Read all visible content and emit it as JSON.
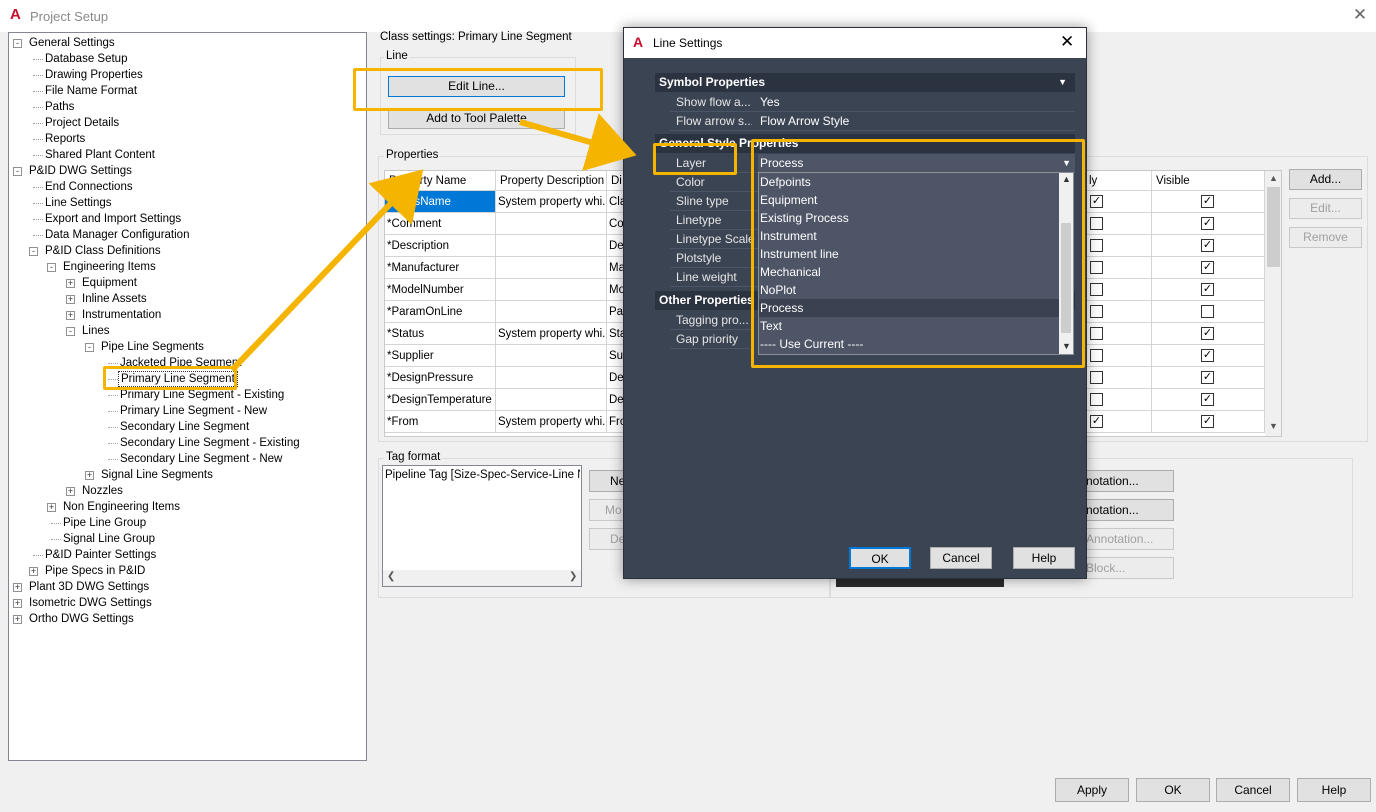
{
  "window": {
    "title": "Project Setup",
    "logo": "A"
  },
  "tree": [
    {
      "label": "General Settings",
      "level": 0,
      "toggle": "-"
    },
    {
      "label": "Database Setup",
      "level": 1
    },
    {
      "label": "Drawing Properties",
      "level": 1
    },
    {
      "label": "File Name Format",
      "level": 1
    },
    {
      "label": "Paths",
      "level": 1
    },
    {
      "label": "Project Details",
      "level": 1
    },
    {
      "label": "Reports",
      "level": 1
    },
    {
      "label": "Shared Plant Content",
      "level": 1
    },
    {
      "label": "P&ID DWG Settings",
      "level": 0,
      "toggle": "-"
    },
    {
      "label": "End Connections",
      "level": 1
    },
    {
      "label": "Line Settings",
      "level": 1
    },
    {
      "label": "Export and Import Settings",
      "level": 1
    },
    {
      "label": "Data Manager Configuration",
      "level": 1
    },
    {
      "label": "P&ID Class Definitions",
      "level": 1,
      "toggle": "-"
    },
    {
      "label": "Engineering Items",
      "level": 2,
      "toggle": "-"
    },
    {
      "label": "Equipment",
      "level": 3,
      "toggle": "+"
    },
    {
      "label": "Inline Assets",
      "level": 3,
      "toggle": "+"
    },
    {
      "label": "Instrumentation",
      "level": 3,
      "toggle": "+"
    },
    {
      "label": "Lines",
      "level": 3,
      "toggle": "-"
    },
    {
      "label": "Pipe Line Segments",
      "level": 4,
      "toggle": "-"
    },
    {
      "label": "Jacketed Pipe Segment",
      "level": 5
    },
    {
      "label": "Primary Line Segment",
      "level": 5,
      "selected": true
    },
    {
      "label": "Primary Line Segment - Existing",
      "level": 5
    },
    {
      "label": "Primary Line Segment - New",
      "level": 5
    },
    {
      "label": "Secondary Line Segment",
      "level": 5
    },
    {
      "label": "Secondary Line Segment - Existing",
      "level": 5
    },
    {
      "label": "Secondary Line Segment - New",
      "level": 5
    },
    {
      "label": "Signal Line Segments",
      "level": 4,
      "toggle": "+"
    },
    {
      "label": "Nozzles",
      "level": 3,
      "toggle": "+"
    },
    {
      "label": "Non Engineering Items",
      "level": 2,
      "toggle": "+"
    },
    {
      "label": "Pipe Line Group",
      "level": 2
    },
    {
      "label": "Signal Line Group",
      "level": 2
    },
    {
      "label": "P&ID Painter Settings",
      "level": 1
    },
    {
      "label": "Pipe Specs in P&ID",
      "level": 1,
      "toggle": "+"
    },
    {
      "label": "Plant 3D DWG Settings",
      "level": 0,
      "toggle": "+"
    },
    {
      "label": "Isometric DWG Settings",
      "level": 0,
      "toggle": "+"
    },
    {
      "label": "Ortho DWG Settings",
      "level": 0,
      "toggle": "+"
    }
  ],
  "class_settings": {
    "heading": "Class settings: Primary Line Segment",
    "line_group": "Line",
    "edit_line": "Edit Line...",
    "add_tool_palette": "Add to Tool Palette",
    "properties_group": "Properties",
    "tag_format_group": "Tag format"
  },
  "properties_table": {
    "headers": [
      "Property Name",
      "Property Description",
      "Di",
      "ly",
      "Visible"
    ],
    "rows": [
      {
        "name": "*ClassName",
        "desc": "System property whi...",
        "di": "Cla",
        "ro": true,
        "visible": true,
        "selected": true
      },
      {
        "name": "*Comment",
        "desc": "",
        "di": "Co",
        "ro": false,
        "visible": true
      },
      {
        "name": "*Description",
        "desc": "",
        "di": "De",
        "ro": false,
        "visible": true
      },
      {
        "name": "*Manufacturer",
        "desc": "",
        "di": "Ma",
        "ro": false,
        "visible": true
      },
      {
        "name": "*ModelNumber",
        "desc": "",
        "di": "Mo",
        "ro": false,
        "visible": true
      },
      {
        "name": "*ParamOnLine",
        "desc": "",
        "di": "Pa",
        "ro": false,
        "visible": false
      },
      {
        "name": "*Status",
        "desc": "System property whi...",
        "di": "Sta",
        "ro": false,
        "visible": true
      },
      {
        "name": "*Supplier",
        "desc": "",
        "di": "Su",
        "ro": false,
        "visible": true
      },
      {
        "name": "*DesignPressure",
        "desc": "",
        "di": "De",
        "ro": false,
        "visible": true
      },
      {
        "name": "*DesignTemperature",
        "desc": "",
        "di": "De",
        "ro": false,
        "visible": true
      },
      {
        "name": "*From",
        "desc": "System property whi...",
        "di": "Fro",
        "ro": true,
        "visible": true
      }
    ]
  },
  "side_buttons": {
    "add": "Add...",
    "edit": "Edit...",
    "remove": "Remove"
  },
  "tag_format": {
    "text": "Pipeline Tag [Size-Spec-Service-Line Nur",
    "btn_new": "Ne",
    "btn_modify": "Mo",
    "btn_delete": "De"
  },
  "annotation_buttons": [
    "notation...",
    "notation...",
    "Annotation...",
    "Block..."
  ],
  "bottom_buttons": {
    "apply": "Apply",
    "ok": "OK",
    "cancel": "Cancel",
    "help": "Help"
  },
  "line_settings": {
    "title": "Line Settings",
    "symbol_section": "Symbol Properties",
    "symbol_rows": [
      {
        "key": "Show flow a...",
        "value": "Yes"
      },
      {
        "key": "Flow arrow s...",
        "value": "Flow Arrow Style"
      }
    ],
    "general_section": "General Style Properties",
    "general_rows": [
      "Layer",
      "Color",
      "Sline type",
      "Linetype",
      "Linetype Scale",
      "Plotstyle",
      "Line weight"
    ],
    "layer_value": "Process",
    "other_section": "Other Properties",
    "other_rows": [
      "Tagging pro...",
      "Gap priority"
    ],
    "layer_options": [
      "Defpoints",
      "Equipment",
      "Existing Process",
      "Instrument",
      "Instrument line",
      "Mechanical",
      "NoPlot",
      "Process",
      "Text",
      "---- Use Current ----"
    ],
    "layer_selected": "Process",
    "ok": "OK",
    "cancel": "Cancel",
    "help": "Help"
  },
  "colors": {
    "highlight": "#f4b400",
    "dialog_bg": "#3b4453",
    "selection": "#0078d7"
  }
}
